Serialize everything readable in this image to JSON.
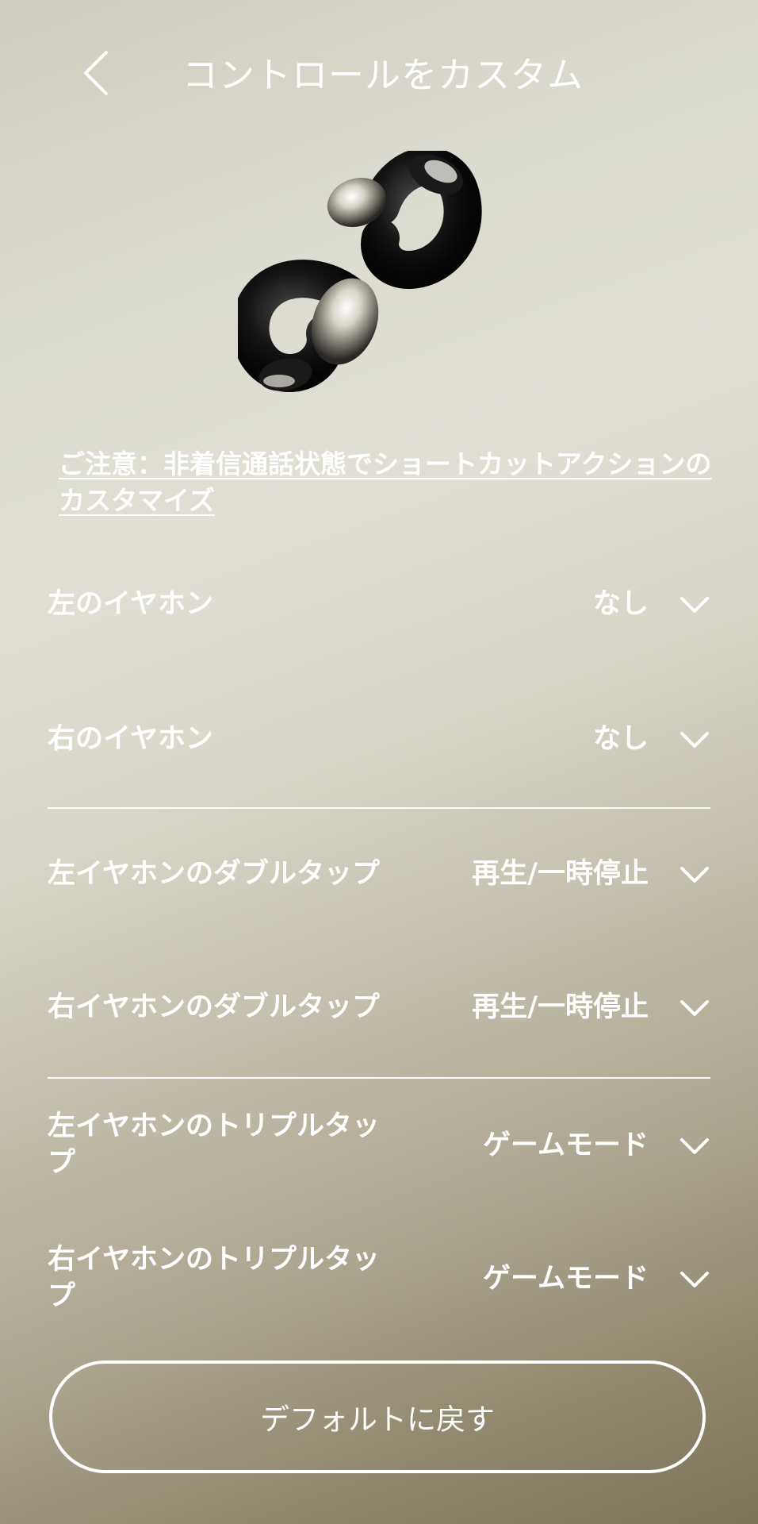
{
  "header": {
    "title": "コントロールをカスタム"
  },
  "notice": {
    "text": "ご注意：非着信通話状態でショートカットアクションのカスタマイズ"
  },
  "controls": [
    {
      "label": "左のイヤホン",
      "value": "なし"
    },
    {
      "label": "右のイヤホン",
      "value": "なし"
    },
    {
      "label": "左イヤホンのダブルタップ",
      "value": "再生/一時停止"
    },
    {
      "label": "右イヤホンのダブルタップ",
      "value": "再生/一時停止"
    },
    {
      "label": "左イヤホンのトリプルタップ",
      "value": "ゲームモード"
    },
    {
      "label": "右イヤホンのトリプルタップ",
      "value": "ゲームモード"
    }
  ],
  "reset": {
    "label": "デフォルトに戻す"
  },
  "icons": {
    "back": "chevron-left-icon",
    "dropdown": "chevron-down-icon",
    "product": "earbuds-image"
  },
  "colors": {
    "text": "#ffffff"
  }
}
